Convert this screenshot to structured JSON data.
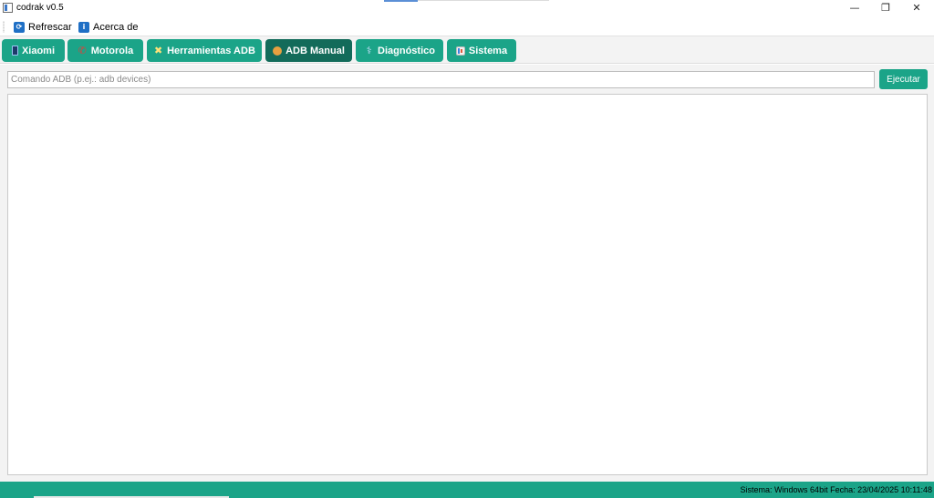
{
  "window": {
    "title": "codrak v0.5",
    "controls": {
      "minimize": "—",
      "maximize": "❐",
      "close": "✕"
    }
  },
  "menubar": {
    "items": [
      {
        "label": "Refrescar",
        "icon": "refresh-icon"
      },
      {
        "label": "Acerca de",
        "icon": "info-icon"
      }
    ]
  },
  "tabs": [
    {
      "label": "Xiaomi",
      "icon": "phone-icon"
    },
    {
      "label": "Motorola",
      "icon": "call-icon"
    },
    {
      "label": "Herramientas ADB",
      "icon": "tools-icon"
    },
    {
      "label": "ADB Manual",
      "icon": "mobile-icon",
      "active": true
    },
    {
      "label": "Diagnóstico",
      "icon": "stethoscope-icon"
    },
    {
      "label": "Sistema",
      "icon": "chart-icon"
    }
  ],
  "command": {
    "placeholder": "Comando ADB (p.ej.: adb devices)",
    "value": "",
    "execute_label": "Ejecutar"
  },
  "statusbar": {
    "text": "Sistema: Windows 64bit  Fecha: 23/04/2025 10:11:48"
  },
  "colors": {
    "accent": "#1ba488",
    "active_tab": "#136b5a"
  }
}
